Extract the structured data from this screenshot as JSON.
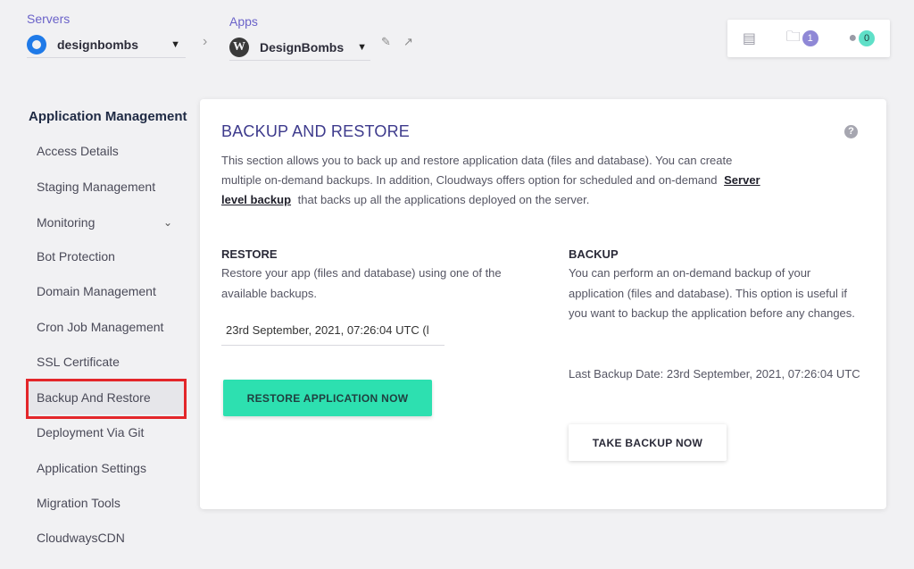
{
  "topbar": {
    "servers_label": "Servers",
    "server_name": "designbombs",
    "apps_label": "Apps",
    "app_name": "DesignBombs",
    "notifications_count": "1",
    "users_count": "0"
  },
  "sidebar": {
    "title": "Application Management",
    "items": [
      {
        "label": "Access Details"
      },
      {
        "label": "Staging Management"
      },
      {
        "label": "Monitoring"
      },
      {
        "label": "Bot Protection"
      },
      {
        "label": "Domain Management"
      },
      {
        "label": "Cron Job Management"
      },
      {
        "label": "SSL Certificate"
      },
      {
        "label": "Backup And Restore"
      },
      {
        "label": "Deployment Via Git"
      },
      {
        "label": "Application Settings"
      },
      {
        "label": "Migration Tools"
      },
      {
        "label": "CloudwaysCDN"
      }
    ]
  },
  "main": {
    "title": "BACKUP AND RESTORE",
    "description_before": "This section allows you to back up and restore application data (files and database). You can create multiple on-demand backups. In addition, Cloudways offers option for scheduled and on-demand",
    "description_link": "Server level backup",
    "description_after": "that backs up all the applications deployed on the server.",
    "restore": {
      "title": "RESTORE",
      "text": "Restore your app (files and database) using one of the available backups.",
      "selected_backup": "23rd September, 2021, 07:26:04 UTC (l",
      "button": "RESTORE APPLICATION NOW"
    },
    "backup": {
      "title": "BACKUP",
      "text": "You can perform an on-demand backup of your application (files and database). This option is useful if you want to backup the application before any changes.",
      "last_backup": "Last Backup Date: 23rd September, 2021, 07:26:04 UTC",
      "button": "TAKE BACKUP NOW"
    }
  },
  "colors": {
    "accent": "#3d3a8c",
    "primary_button": "#2de0b0",
    "highlight": "#e3262a"
  }
}
